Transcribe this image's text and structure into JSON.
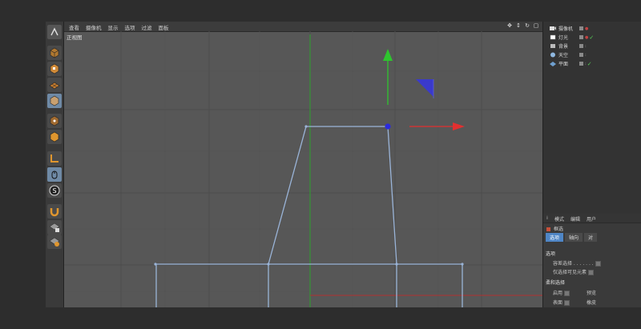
{
  "viewport": {
    "menu": [
      "查看",
      "摄像机",
      "显示",
      "选项",
      "过滤",
      "面板"
    ],
    "view_label": "正视图"
  },
  "objects": [
    {
      "name": "摄像机",
      "icon": "camera-icon"
    },
    {
      "name": "灯光",
      "icon": "light-icon"
    },
    {
      "name": "背景",
      "icon": "background-icon"
    },
    {
      "name": "天空",
      "icon": "sky-icon"
    },
    {
      "name": "平面",
      "icon": "plane-icon"
    }
  ],
  "attributes": {
    "menu": [
      "模式",
      "编辑",
      "用户"
    ],
    "title": "框选",
    "tabs": [
      "选项",
      "轴向",
      "对"
    ],
    "section_options": "选项",
    "opt_tolerant": "容差选择 . . . . . . .",
    "opt_visible_only": "仅选择可见元素",
    "section_soft": "柔和选择",
    "opt_enable": "启用",
    "opt_preview": "预览",
    "opt_surface": "表面",
    "opt_rubber": "橡皮"
  },
  "colors": {
    "viewport_bg": "#575757",
    "spline": "#9ab4d8",
    "axis_x": "#e23030",
    "axis_y": "#2ec52e",
    "axis_z": "#3333cc",
    "active_tab": "#4f86c6"
  }
}
